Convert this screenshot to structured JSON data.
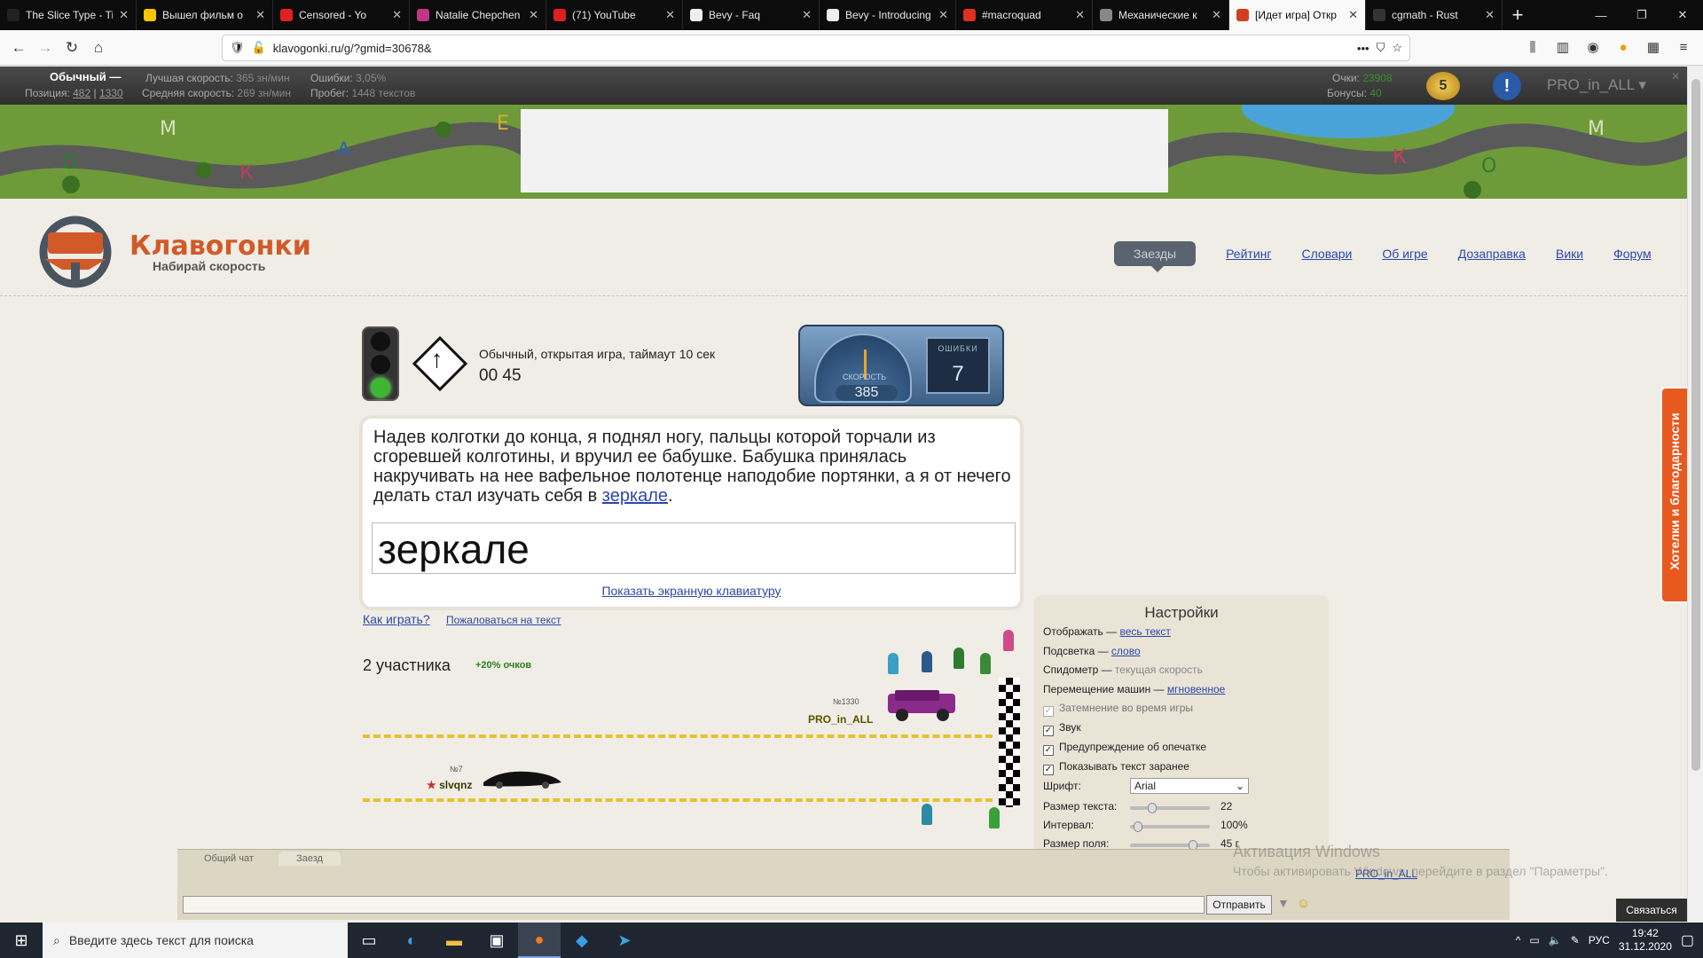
{
  "browser": {
    "tabs": [
      {
        "title": "The Slice Type - Ti",
        "color": "#222"
      },
      {
        "title": "Вышел фильм о",
        "color": "#f6c700"
      },
      {
        "title": "Censored - Yo",
        "color": "#e02020"
      },
      {
        "title": "Natalie Chepchen",
        "color": "#c13584"
      },
      {
        "title": "(71) YouTube",
        "color": "#e02020"
      },
      {
        "title": "Bevy - Faq",
        "color": "#eee"
      },
      {
        "title": "Bevy - Introducing",
        "color": "#eee"
      },
      {
        "title": "#macroquad",
        "color": "#e03020"
      },
      {
        "title": "Механические к",
        "color": "#888"
      },
      {
        "title": "[Идет игра] Откр",
        "color": "#d04020"
      },
      {
        "title": "cgmath - Rust",
        "color": "#333"
      }
    ],
    "url": "klavogonki.ru/g/?gmid=30678&"
  },
  "stats": {
    "mode": "Обычный",
    "best_speed_label": "Лучшая скорость:",
    "best_speed": "365 зн/мин",
    "errors_label": "Ошибки:",
    "errors": "3,05%",
    "position_label": "Позиция:",
    "position": "482",
    "position_total": "1330",
    "avg_speed_label": "Средняя скорость:",
    "avg_speed": "269 зн/мин",
    "mileage_label": "Пробег:",
    "mileage": "1448 текстов",
    "points_label": "Очки:",
    "points": "23908",
    "bonus_label": "Бонусы:",
    "bonus": "40",
    "level": "5",
    "username": "PRO_in_ALL"
  },
  "site": {
    "logo_title": "Клавогонки",
    "logo_subtitle": "Набирай скорость",
    "menu": [
      "Заезды",
      "Рейтинг",
      "Словари",
      "Об игре",
      "Дозаправка",
      "Вики",
      "Форум"
    ]
  },
  "game": {
    "description": "Обычный, открытая игра, таймаут 10 сек",
    "timer": "00 45",
    "speed_label": "СКОРОСТЬ",
    "speed": "385",
    "errors_label": "ОШИБКИ",
    "errors": "7",
    "text_before": "Надев колготки до конца, я поднял ногу, пальцы которой торчали из сгоревшей колготины, и вручил ее бабушке. Бабушка принялась накручивать на нее вафельное полотенце наподобие портянки, а я от нечего делать стал изучать себя в ",
    "text_current": "зеркале",
    "text_after": ".",
    "input_value": "зеркале",
    "show_keyboard": "Показать экранную клавиатуру",
    "how_to_play": "Как играть?",
    "complain": "Пожаловаться на текст",
    "participants": "2 участника",
    "participants_bonus": "+20% очков",
    "players": [
      {
        "num": "№1330",
        "name": "PRO_in_ALL"
      },
      {
        "num": "№7",
        "name": "slvqnz"
      }
    ]
  },
  "settings": {
    "title": "Настройки",
    "display_label": "Отображать —",
    "display_value": "весь текст",
    "highlight_label": "Подсветка —",
    "highlight_value": "слово",
    "speedometer_label": "Спидометр —",
    "speedometer_value": "текущая скорость",
    "car_move_label": "Перемещение машин —",
    "car_move_value": "мгновенное",
    "dim_label": "Затемнение во время игры",
    "sound_label": "Звук",
    "typo_warn_label": "Предупреждение об опечатке",
    "show_text_label": "Показывать текст заранее",
    "font_label": "Шрифт:",
    "font_value": "Arial",
    "text_size_label": "Размер текста:",
    "text_size_value": "22",
    "interval_label": "Интервал:",
    "interval_value": "100%",
    "field_size_label": "Размер поля:",
    "field_size_value": "45 г"
  },
  "feedback": "Хотелки и благодарности",
  "chat": {
    "tab_general": "Общий чат",
    "tab_race": "Заезд",
    "send": "Отправить",
    "user": "PRO_in_ALL"
  },
  "windows": {
    "activation_title": "Активация Windows",
    "activation_text": "Чтобы активировать Windows, перейдите в раздел \"Параметры\".",
    "contact": "Связаться",
    "search_placeholder": "Введите здесь текст для поиска",
    "lang": "РУС",
    "time": "19:42",
    "date": "31.12.2020"
  }
}
